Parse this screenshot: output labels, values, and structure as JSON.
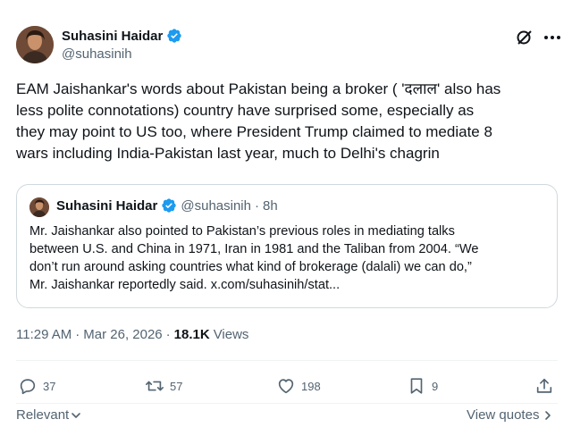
{
  "tweet": {
    "author_name": "Suhasini Haidar",
    "handle": "@suhasinih",
    "text": "EAM Jaishankar's words about Pakistan being a broker ( 'दलाल' also has\nless polite connotations) country have surprised some, especially as\nthey may point to US too, where President Trump claimed to mediate 8\nwars including India-Pakistan last year, much to Delhi's chagrin",
    "time": "11:29 AM",
    "separator": "·",
    "date": "Mar 26, 2026",
    "views_count": "18.1K",
    "views_label": "Views"
  },
  "quote": {
    "author_name": "Suhasini Haidar",
    "handle": "@suhasinih",
    "separator": "·",
    "age": "8h",
    "text": "Mr. Jaishankar also pointed to Pakistan’s previous roles in mediating talks\nbetween U.S. and China in 1971, Iran in 1981 and the Taliban from 2004. “We\ndon’t run around asking countries what kind of brokerage (dalali) we can do,”\nMr. Jaishankar reportedly said. x.com/suhasinih/stat..."
  },
  "actions": {
    "replies": "37",
    "reposts": "57",
    "likes": "198",
    "bookmarks": "9"
  },
  "footer": {
    "sort_label": "Relevant",
    "view_quotes_label": "View quotes"
  },
  "icons": [
    "grok-icon",
    "more-icon",
    "verified-badge-icon",
    "reply-icon",
    "repost-icon",
    "like-icon",
    "bookmark-icon",
    "share-icon",
    "chevron-down-icon",
    "chevron-right-icon"
  ],
  "colors": {
    "text": "#0f1419",
    "secondary": "#536471",
    "verified": "#1d9bf0",
    "border": "#cfd9de"
  }
}
